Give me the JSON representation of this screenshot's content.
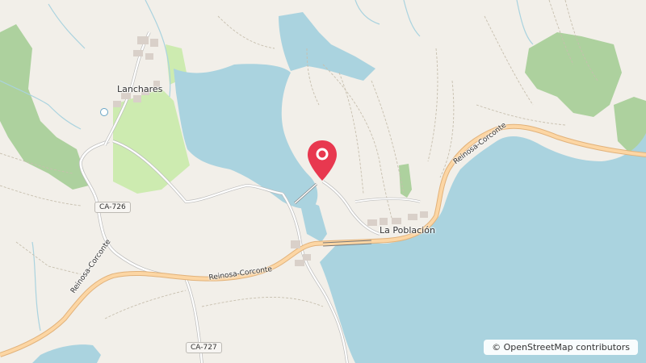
{
  "map": {
    "places": {
      "lanchares": "Lanchares",
      "la_poblacion": "La Población"
    },
    "roads": {
      "ca726": "CA-726",
      "ca727": "CA-727",
      "reinosa_corconte_west": "Reinosa-Corconte",
      "reinosa_corconte_mid": "Reinosa-Corconte",
      "reinosa_corconte_east": "Reinosa-Corconte"
    },
    "attribution": "© OpenStreetMap contributors",
    "colors": {
      "water": "#aad3df",
      "land": "#f2efe9",
      "forest": "#add19e",
      "meadow": "#cdebb0",
      "main_road": "#fcd6a4",
      "road_casing": "#e2b27a",
      "marker": "#e8384f"
    }
  }
}
